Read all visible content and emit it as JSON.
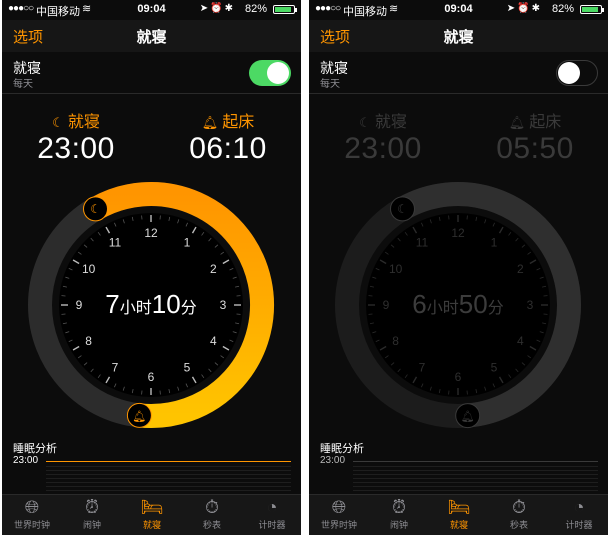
{
  "status_bar": {
    "signal": "●●●○○",
    "carrier": "中国移动",
    "time": "09:04",
    "battery": "82%",
    "battery_fraction": 0.82
  },
  "nav": {
    "left_label": "选项",
    "title": "就寝"
  },
  "bedtime_row": {
    "label": "就寝",
    "sublabel": "每天"
  },
  "time_labels": {
    "bedtime": "就寝",
    "wake": "起床"
  },
  "sleep_analysis_label": "睡眠分析",
  "tabs": [
    {
      "icon": "globe-icon",
      "label": "世界时钟"
    },
    {
      "icon": "alarm-clock-icon",
      "label": "闹钟"
    },
    {
      "icon": "bed-icon",
      "label": "就寝"
    },
    {
      "icon": "stopwatch-icon",
      "label": "秒表"
    },
    {
      "icon": "timer-icon",
      "label": "计时器"
    }
  ],
  "screens": [
    {
      "toggle_on": true,
      "bedtime": "23:00",
      "wake": "06:10",
      "duration": {
        "hours": "7",
        "hours_unit": "小时",
        "minutes": "10",
        "minutes_unit": "分"
      },
      "chart_start": "23:00"
    },
    {
      "toggle_on": false,
      "bedtime": "23:00",
      "wake": "05:50",
      "duration": {
        "hours": "6",
        "hours_unit": "小时",
        "minutes": "50",
        "minutes_unit": "分"
      },
      "chart_start": "23:00"
    }
  ],
  "dial_numbers": [
    "12",
    "1",
    "2",
    "3",
    "4",
    "5",
    "6",
    "7",
    "8",
    "9",
    "10",
    "11"
  ],
  "colors": {
    "accent": "#ff9500",
    "accent_light": "#ffbf00",
    "toggle_on": "#4cd964",
    "track": "#2c2c2c"
  }
}
